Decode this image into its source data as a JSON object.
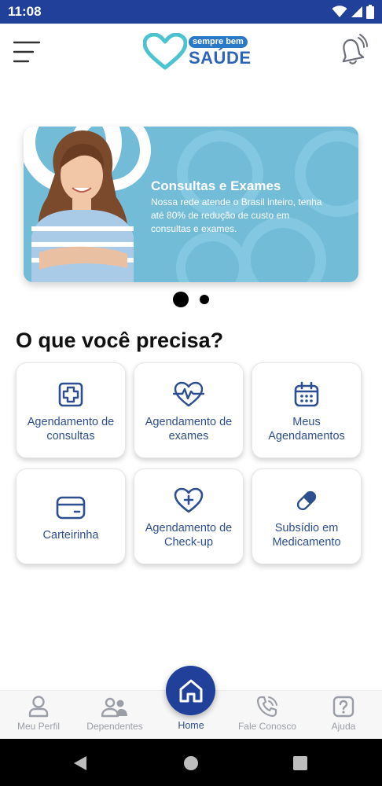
{
  "status_bar": {
    "time": "11:08"
  },
  "header": {
    "logo_tagline": "sempre bem",
    "logo_word": "SAÚDE"
  },
  "banner": {
    "title": "Consultas e Exames",
    "text": "Nossa rede atende o Brasil inteiro, tenha até 80% de redução de custo em consultas e exames.",
    "page_count": 2,
    "active_page": 1
  },
  "section": {
    "title": "O que você precisa?"
  },
  "services": [
    {
      "label": "Agendamento de consultas",
      "icon": "medical-cross-icon"
    },
    {
      "label": "Agendamento de exames",
      "icon": "heartbeat-icon"
    },
    {
      "label": "Meus Agendamentos",
      "icon": "calendar-icon"
    },
    {
      "label": "Carteirinha",
      "icon": "card-icon"
    },
    {
      "label": "Agendamento de Check-up",
      "icon": "heart-plus-icon"
    },
    {
      "label": "Subsídio em Medicamento",
      "icon": "pill-icon"
    }
  ],
  "bottom_nav": {
    "profile": "Meu Perfil",
    "dependents": "Dependentes",
    "home": "Home",
    "contact": "Fale Conosco",
    "help": "Ajuda"
  },
  "colors": {
    "primary": "#21409a",
    "accent_blue": "#2d64b8",
    "banner_bg": "#72bcd8",
    "logo_teal": "#4cc3cf",
    "icon_blue": "#2d4f8f"
  }
}
